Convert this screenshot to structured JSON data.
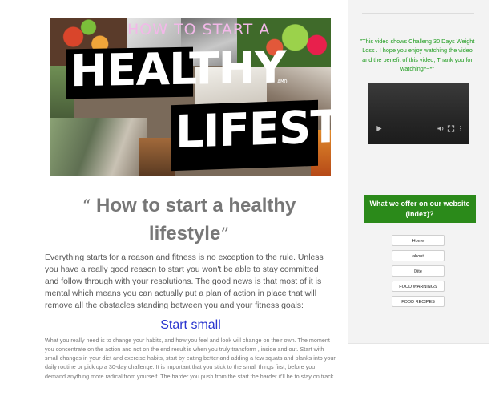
{
  "hero": {
    "subtitle": "HOW TO START A",
    "line1": "HEALTHY",
    "line2": "LIFESTYLE",
    "stamp": "AMO"
  },
  "article": {
    "title_open_quote": "“",
    "title_text": " How to start a healthy lifestyle",
    "title_close_quote": "”",
    "intro": "Everything starts for a reason and fitness is no exception to the rule. Unless you have a really good reason to start you won't be able to stay committed and follow through with your resolutions. The good news is that most of it is mental which means you can actually put a plan of action in place that will remove all the obstacles standing between you and your fitness goals:",
    "section_heading": "Start small",
    "section_body": "What you really need is to change your habits, and how you feel and look will change on their own. The moment you concentrate on the action and not on the end result is when you truly transform , inside and out. Start with small changes in your diet and exercise habits, start by eating better and adding a few squats and planks into your daily routine or pick up a 30-day challenge. It is important that you stick to the small things first, before you demand anything more radical from yourself. The harder you push from the start the harder it'll be to stay on track."
  },
  "sidebar": {
    "video_caption": "\"This video shows Challeng 30 Days Weight Loss . I hope you enjoy watching the video and the benefit of this video, Thank you for watching^~*\"",
    "offer_heading": "What we offer on our website (index)?",
    "nav": [
      "Home",
      "about",
      "Dite",
      "FOOD WARNINGS",
      "FOOD RECIPES"
    ]
  },
  "colors": {
    "accent_green": "#2b8a1a",
    "caption_green": "#1e9c1e",
    "heading_blue": "#2a35cf",
    "title_gray": "#777777"
  }
}
